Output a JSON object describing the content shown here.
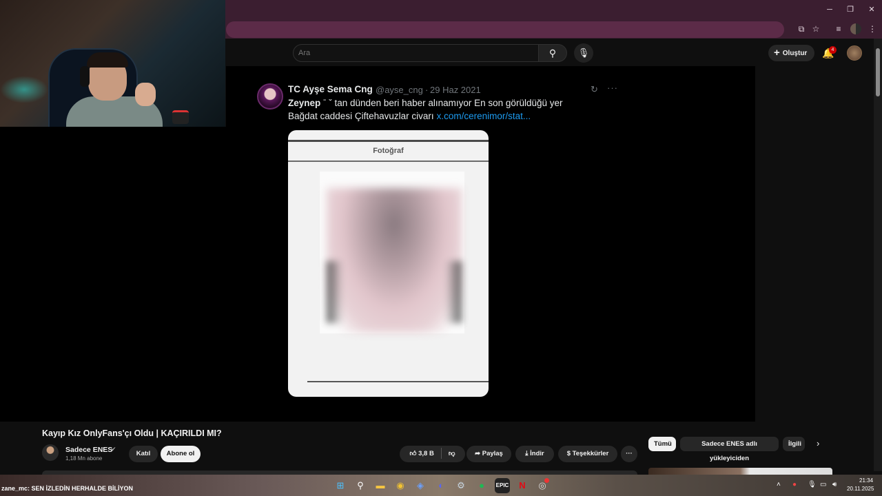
{
  "browser": {
    "window_controls": {
      "minimize": "─",
      "maximize": "❐",
      "close": "✕"
    },
    "toolbar_icons": [
      "cast-icon",
      "star-icon",
      "playlist-icon",
      "profile-icon",
      "menu-icon"
    ]
  },
  "youtube": {
    "search": {
      "placeholder": "Ara",
      "value": ""
    },
    "create_label": "Oluştur",
    "notifications_count": "4"
  },
  "tweet": {
    "author_name": "TC Ayşe Sema Cng",
    "handle": "@ayse_cng",
    "separator": "·",
    "date": "29 Haz 2021",
    "line1_bold": "Zeynep",
    "line1_redacted": " ˉ ˇ ",
    "line1_rest": "tan dünden beri haber alınamıyor En son görüldüğü yer",
    "line2": "Bağdat caddesi Çiftehavuzlar civarı",
    "link": "x.com/cerenimor/stat...",
    "photo_label": "Fotoğraf"
  },
  "video": {
    "title": "Kayıp Kız OnlyFans'çı Oldu | KAÇIRILDI MI?",
    "channel_name": "Sadece ENES",
    "verified_mark": "✔",
    "subscribers": "1,18 Mn abone",
    "join_label": "Katıl",
    "subscribe_label": "Abone ol",
    "like_count": "3,8 B",
    "share_label": "Paylaş",
    "download_label": "İndir",
    "thanks_label": "Teşekkürler"
  },
  "chips": {
    "all": "Tümü",
    "channel": "Sadece ENES adlı yükleyiciden",
    "related": "İlgili"
  },
  "taskbar": {
    "chat_user": "zane_mc",
    "chat_message": ": SEN İZLEDİN HERHALDE BİLİYON",
    "epic_label": "EPIC",
    "netflix_label": "N",
    "time": "21:34",
    "date": "20.11.2025"
  },
  "colors": {
    "browser_frame": "#3b1e30",
    "youtube_bg": "#0f0f0f",
    "link": "#1d9bf0",
    "notification_badge": "#cc0000"
  }
}
